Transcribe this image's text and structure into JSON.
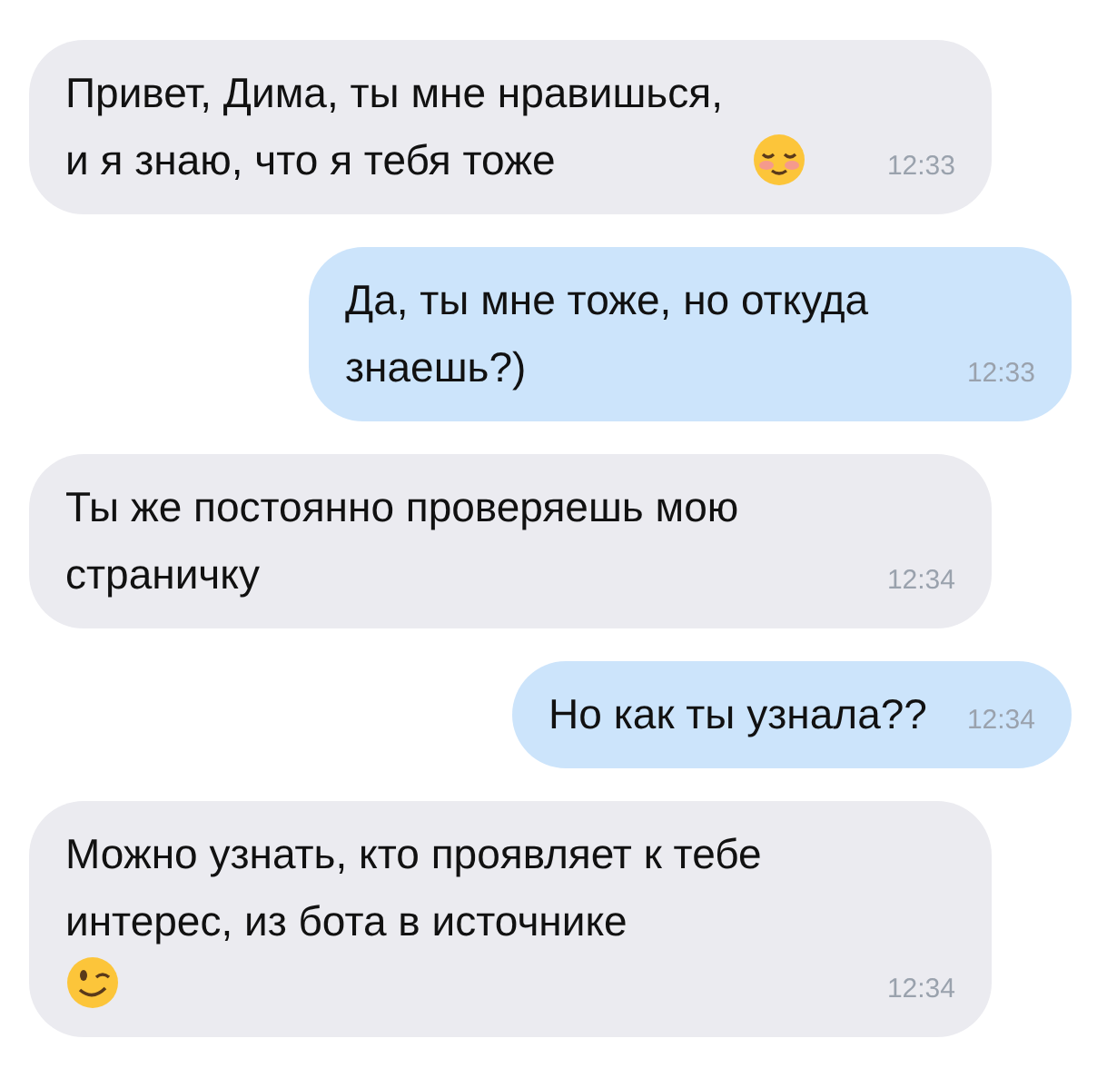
{
  "messages": [
    {
      "kind": "incoming",
      "text": "Привет, Дима, ты мне нравишься, и я знаю, что я тебя тоже",
      "emoji": {
        "kind": "smile"
      },
      "time": "12:33"
    },
    {
      "kind": "outgoing",
      "text": "Да, ты мне тоже, но откуда знаешь?)",
      "time": "12:33"
    },
    {
      "kind": "incoming",
      "text": "Ты же постоянно проверяешь мою страничку",
      "time": "12:34"
    },
    {
      "kind": "outgoing",
      "text": "Но как ты узнала??",
      "time": "12:34"
    },
    {
      "kind": "incoming",
      "text": "Можно узнать, кто проявляет к тебе интерес, из бота в источнике",
      "emoji": {
        "kind": "wink"
      },
      "time": "12:34"
    }
  ]
}
